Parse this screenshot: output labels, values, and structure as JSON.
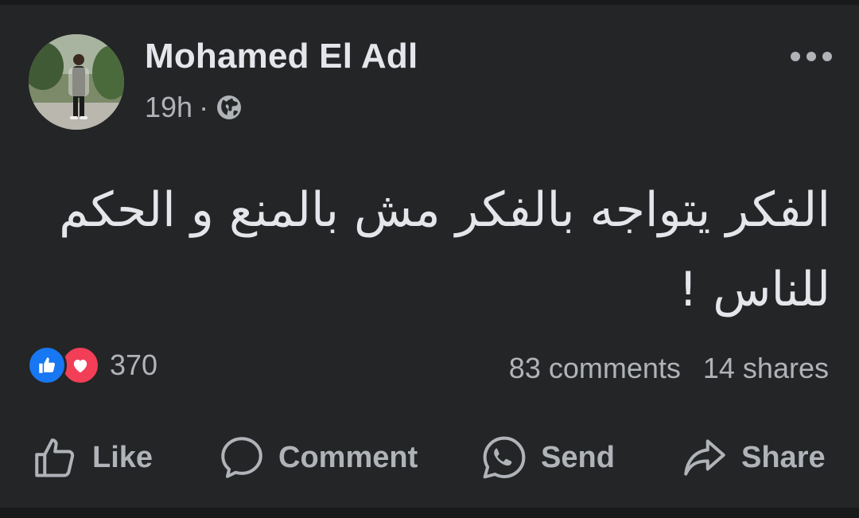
{
  "post": {
    "author": "Mohamed El Adl",
    "time": "19h",
    "separator": "·",
    "privacy_icon": "globe-icon",
    "text": "الفكر يتواجه بالفكر مش بالمنع و الحكم للناس !"
  },
  "reactions": {
    "icons": [
      "like-reaction-icon",
      "love-reaction-icon"
    ],
    "count": "370"
  },
  "stats": {
    "comments": "83 comments",
    "shares": "14 shares"
  },
  "actions": {
    "like": "Like",
    "comment": "Comment",
    "send": "Send",
    "share": "Share"
  },
  "colors": {
    "background": "#242526",
    "text": "#e4e6eb",
    "secondary_text": "#b0b3b8",
    "like_blue": "#1877f2",
    "love_red": "#f33e58"
  }
}
